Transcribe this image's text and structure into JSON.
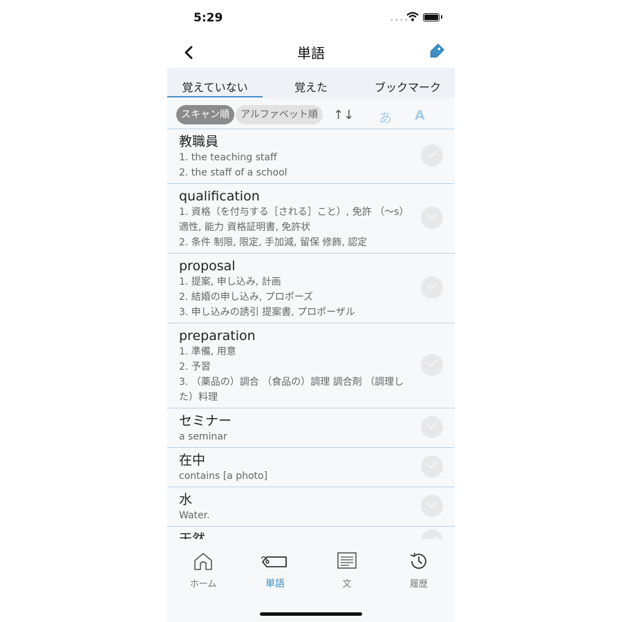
{
  "status": {
    "time": "5:29"
  },
  "header": {
    "title": "単語"
  },
  "tabs": [
    {
      "label": "覚えていない"
    },
    {
      "label": "覚えた"
    },
    {
      "label": "ブックマーク"
    }
  ],
  "sort": {
    "scan_order": "スキャン順",
    "alpha_order": "アルファベット順",
    "font_ja": "あ",
    "font_en": "A"
  },
  "words": [
    {
      "word": "教職員",
      "definition": [
        "1. the teaching staff",
        "2. the staff of a school"
      ]
    },
    {
      "word": "qualification",
      "definition": [
        "1. 資格（を付与する［される］こと）, 免許 （～s） 適性, 能力 資格証明書, 免許状",
        "2. 条件 制限, 限定, 手加減, 留保 修飾, 認定"
      ]
    },
    {
      "word": "proposal",
      "definition": [
        "1. 提案, 申し込み, 計画",
        "2. 結婚の申し込み, プロポーズ",
        "3. 申し込みの誘引 提案書, プロポーザル"
      ]
    },
    {
      "word": "preparation",
      "definition": [
        "1. 準備, 用意",
        "2. 予習",
        "3. （薬品の）調合 （食品の）調理 調合剤 （調理した）料理"
      ]
    },
    {
      "word": "セミナー",
      "definition": [
        "a seminar"
      ]
    },
    {
      "word": "在中",
      "definition": [
        "contains [a photo]"
      ]
    },
    {
      "word": "水",
      "definition": [
        "Water."
      ]
    },
    {
      "word": "天然",
      "definition": []
    }
  ],
  "tabbar": [
    {
      "label": "ホーム",
      "icon": "home-icon"
    },
    {
      "label": "単語",
      "icon": "tag-card-icon"
    },
    {
      "label": "文",
      "icon": "document-icon"
    },
    {
      "label": "履歴",
      "icon": "history-icon"
    }
  ],
  "colors": {
    "accent": "#3d8fc4",
    "divider": "#b7d3ea"
  }
}
